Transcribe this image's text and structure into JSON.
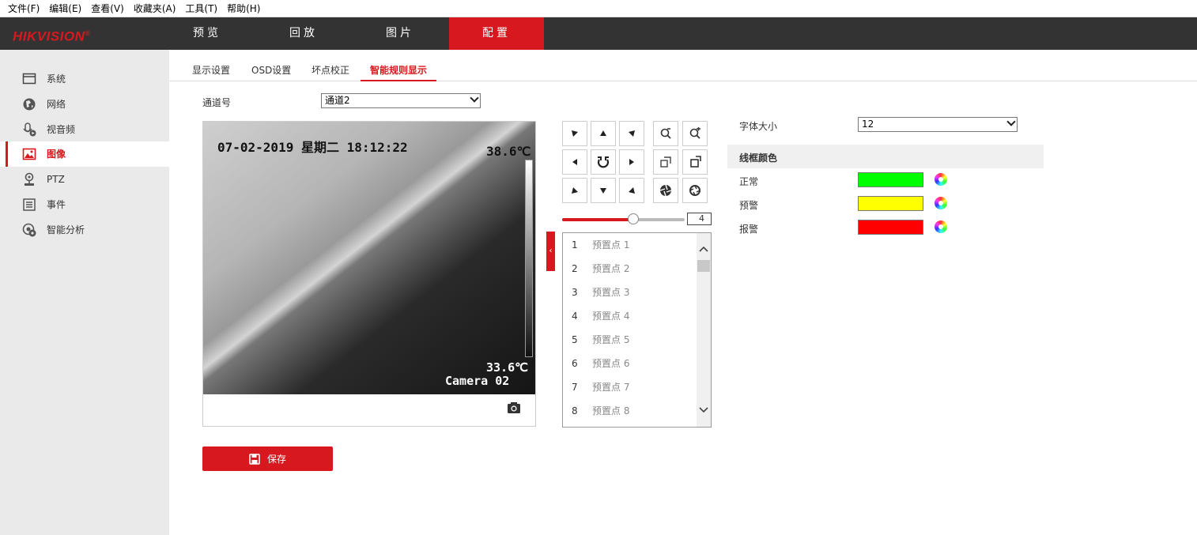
{
  "menubar": [
    "文件(F)",
    "编辑(E)",
    "查看(V)",
    "收藏夹(A)",
    "工具(T)",
    "帮助(H)"
  ],
  "brand": {
    "name": "HIKVISION",
    "mark": "®",
    "accent": "#d7191f"
  },
  "nav": [
    "预览",
    "回放",
    "图片",
    "配置"
  ],
  "nav_active": "配置",
  "sidebar": [
    {
      "label": "系统",
      "icon": "monitor-icon"
    },
    {
      "label": "网络",
      "icon": "globe-icon"
    },
    {
      "label": "视音频",
      "icon": "mic-video-icon"
    },
    {
      "label": "图像",
      "icon": "image-icon"
    },
    {
      "label": "PTZ",
      "icon": "ptz-icon"
    },
    {
      "label": "事件",
      "icon": "list-icon"
    },
    {
      "label": "智能分析",
      "icon": "smart-analysis-icon"
    }
  ],
  "sidebar_active": "图像",
  "subtabs": [
    "显示设置",
    "OSD设置",
    "坏点校正",
    "智能规则显示"
  ],
  "subtab_active": "智能规则显示",
  "channel": {
    "label": "通道号",
    "value": "通道2"
  },
  "video": {
    "datetime": "07-02-2019 星期二 18:12:22",
    "temp_max": "38.6℃",
    "temp_min": "33.6℃",
    "camera_name": "Camera 02"
  },
  "ptz": {
    "speed": "4",
    "speed_fraction": 0.58
  },
  "presets": [
    {
      "num": "1",
      "name": "预置点 1"
    },
    {
      "num": "2",
      "name": "预置点 2"
    },
    {
      "num": "3",
      "name": "预置点 3"
    },
    {
      "num": "4",
      "name": "预置点 4"
    },
    {
      "num": "5",
      "name": "预置点 5"
    },
    {
      "num": "6",
      "name": "预置点 6"
    },
    {
      "num": "7",
      "name": "预置点 7"
    },
    {
      "num": "8",
      "name": "预置点 8"
    }
  ],
  "font_size": {
    "label": "字体大小",
    "value": "12"
  },
  "frame_color": {
    "header": "线框颜色",
    "items": [
      {
        "label": "正常",
        "color": "#00ff00"
      },
      {
        "label": "预警",
        "color": "#ffff00"
      },
      {
        "label": "报警",
        "color": "#ff0000"
      }
    ]
  },
  "save_label": "保存"
}
